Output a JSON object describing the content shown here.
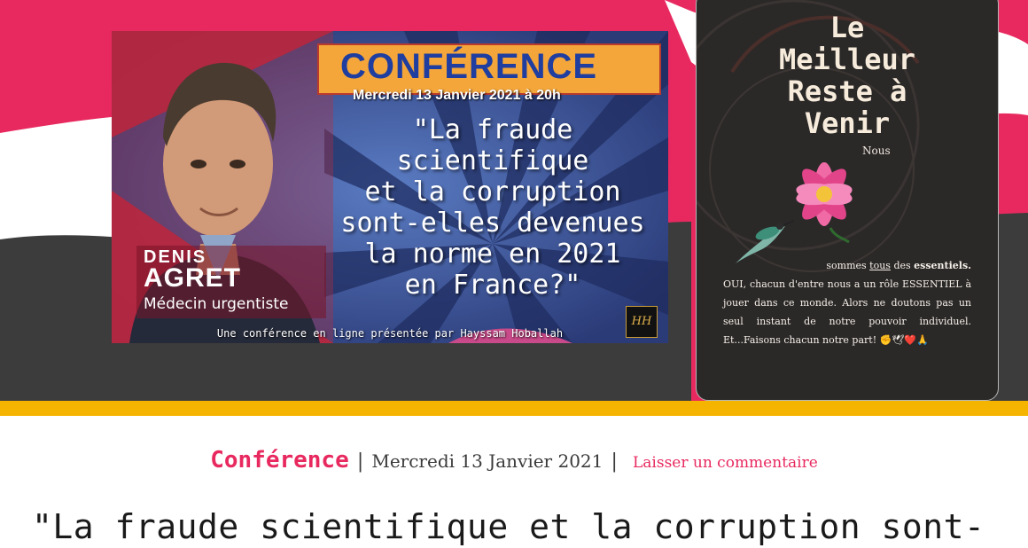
{
  "featured_image": {
    "heading": "CONFÉRENCE",
    "date_line": "Mercredi 13 Janvier 2021 à 20h",
    "quote_lines": [
      "\"La fraude",
      "scientifique",
      "et la corruption",
      "sont-elles devenues",
      "la norme en 2021",
      "en France?\""
    ],
    "speaker_first": "DENIS",
    "speaker_last": "AGRET",
    "speaker_role": "Médecin urgentiste",
    "presented_by": "Une conférence en ligne présentée par Hayssam Hoballah",
    "logo_text": "HH"
  },
  "sidebar": {
    "title_lines": [
      "Le",
      "Meilleur",
      "Reste à",
      "Venir"
    ],
    "nous": "Nous",
    "text_sommes": "sommes ",
    "text_tous": "tous",
    "text_des": " des ",
    "text_essentiels": "essentiels.",
    "text_body": "OUI, chacun d'entre nous a un rôle ESSENTIEL à jouer dans ce monde. Alors ne doutons pas un seul instant de notre pouvoir individuel. Et...Faisons chacun notre part! ✊🕊❤️🙏"
  },
  "meta": {
    "category": "Conférence",
    "separator": "|",
    "date": "Mercredi 13 Janvier 2021",
    "comment_link": "Laisser un commentaire"
  },
  "post": {
    "title_visible": "\"La fraude scientifique et la corruption sont-"
  },
  "colors": {
    "brand_pink": "#e8295f",
    "band_dark": "#3d3c3d",
    "accent_yellow": "#f5b400",
    "card_bg": "#2b2928"
  }
}
